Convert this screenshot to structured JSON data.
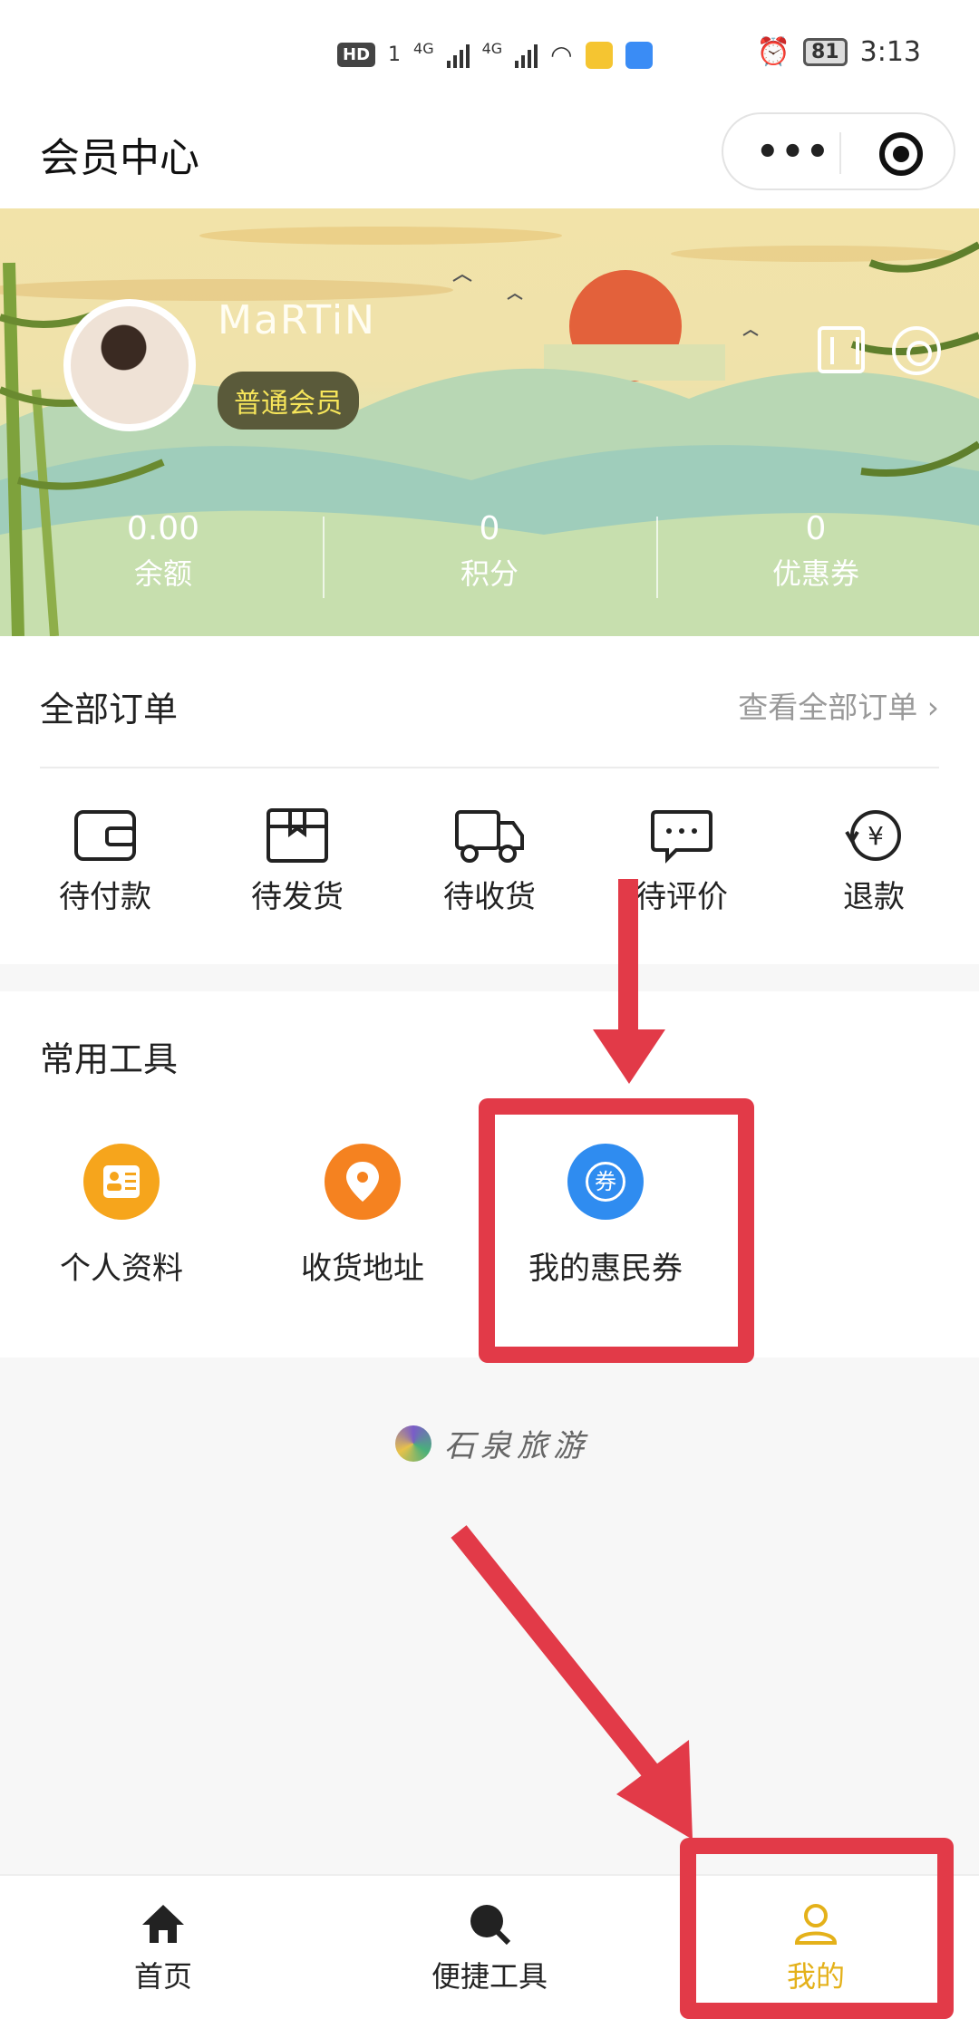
{
  "status_bar": {
    "hd": "HD",
    "sim": "1",
    "net1": "4G",
    "net2": "4G",
    "battery": "81",
    "time": "3:13"
  },
  "header": {
    "title": "会员中心"
  },
  "profile": {
    "username": "MaRTiN",
    "member_level": "普通会员",
    "stats": [
      {
        "value": "0.00",
        "label": "余额"
      },
      {
        "value": "0",
        "label": "积分"
      },
      {
        "value": "0",
        "label": "优惠券"
      }
    ]
  },
  "orders": {
    "title": "全部订单",
    "view_all": "查看全部订单",
    "items": [
      {
        "label": "待付款",
        "icon": "wallet-icon"
      },
      {
        "label": "待发货",
        "icon": "package-icon"
      },
      {
        "label": "待收货",
        "icon": "truck-icon"
      },
      {
        "label": "待评价",
        "icon": "comment-icon"
      },
      {
        "label": "退款",
        "icon": "refund-icon"
      }
    ]
  },
  "tools": {
    "title": "常用工具",
    "items": [
      {
        "label": "个人资料",
        "icon": "profile-card-icon",
        "color": "#f6a51c"
      },
      {
        "label": "收货地址",
        "icon": "location-pin-icon",
        "color": "#f58220"
      },
      {
        "label": "我的惠民券",
        "icon": "coupon-icon",
        "color": "#2f8cf0",
        "glyph": "券"
      }
    ]
  },
  "brand": {
    "text": "石泉旅游"
  },
  "tabbar": {
    "items": [
      {
        "label": "首页",
        "icon": "home-icon"
      },
      {
        "label": "便捷工具",
        "icon": "search-icon"
      },
      {
        "label": "我的",
        "icon": "user-icon",
        "active": true
      }
    ]
  },
  "colors": {
    "accent": "#e4b11a",
    "annotation": "#e23a48",
    "badge_text": "#f6e55a"
  }
}
